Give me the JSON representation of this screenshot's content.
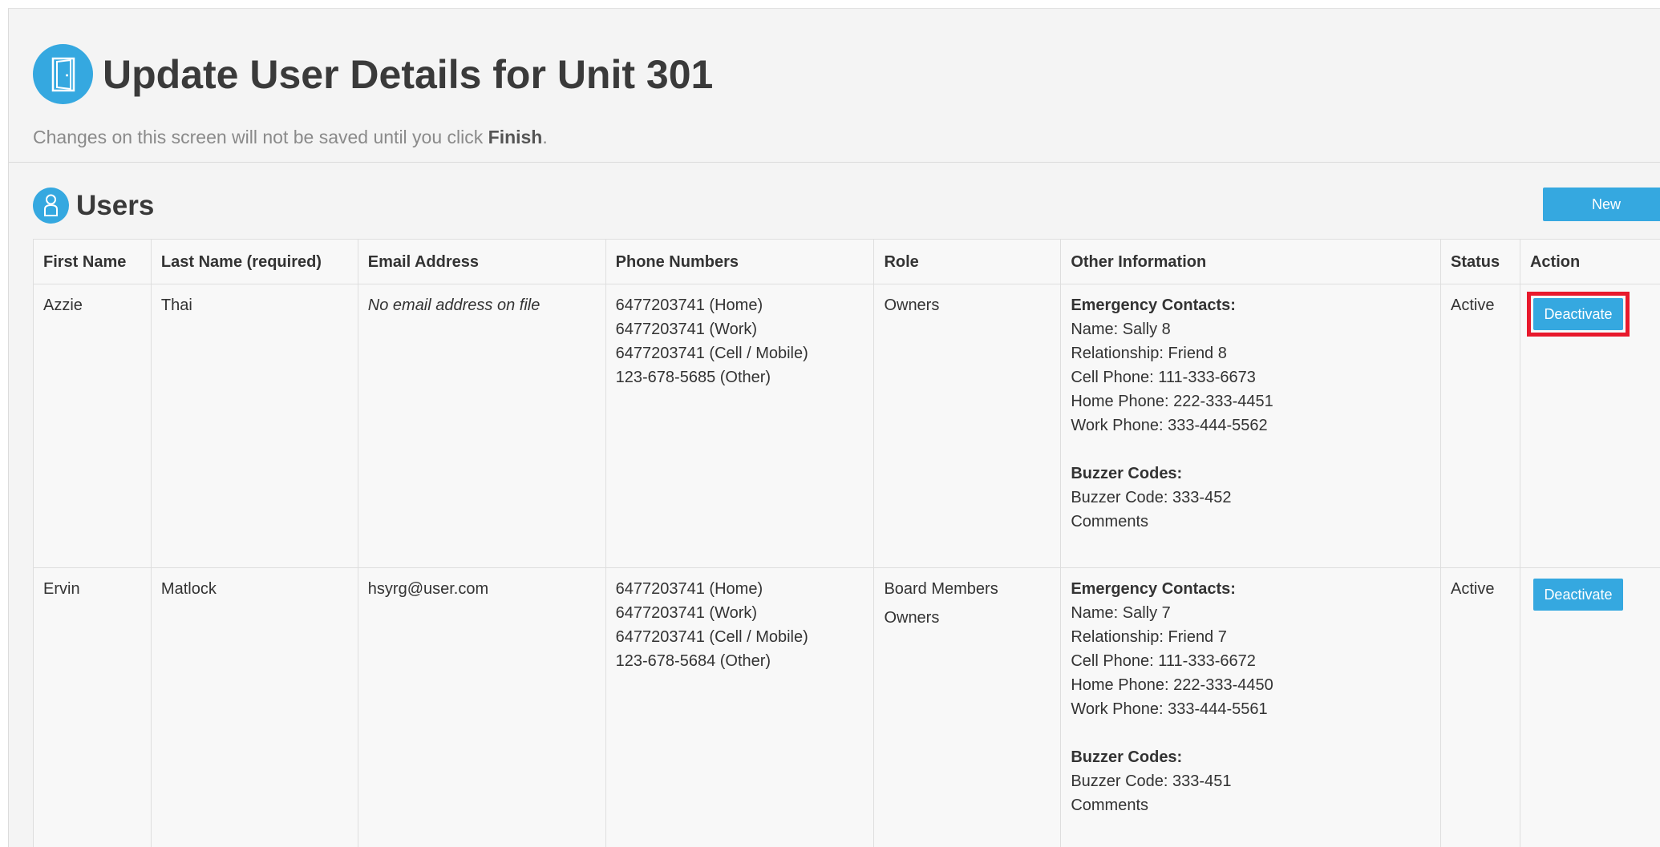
{
  "header": {
    "title": "Update User Details for Unit 301",
    "subtitle_prefix": "Changes on this screen will not be saved until you click ",
    "subtitle_bold": "Finish",
    "subtitle_suffix": ".",
    "icon": "door-icon"
  },
  "users_section": {
    "title": "Users",
    "icon": "person-icon",
    "new_label": "New"
  },
  "table": {
    "columns": [
      "First Name",
      "Last Name (required)",
      "Email Address",
      "Phone Numbers",
      "Role",
      "Other Information",
      "Status",
      "Action"
    ],
    "rows": [
      {
        "first_name": "Azzie",
        "last_name": "Thai",
        "email": "No email address on file",
        "phones": [
          "6477203741 (Home)",
          "6477203741 (Work)",
          "6477203741 (Cell / Mobile)",
          "123-678-5685 (Other)"
        ],
        "roles": [
          "Owners"
        ],
        "emergency_heading": "Emergency Contacts:",
        "emergency": [
          "Name: Sally 8",
          "Relationship: Friend 8",
          "Cell Phone: 111-333-6673",
          "Home Phone: 222-333-4451",
          "Work Phone: 333-444-5562"
        ],
        "buzzer_heading": "Buzzer Codes:",
        "buzzer": [
          "Buzzer Code: 333-452",
          "Comments"
        ],
        "status": "Active",
        "action_label": "Deactivate"
      },
      {
        "first_name": "Ervin",
        "last_name": "Matlock",
        "email": "hsyrg@user.com",
        "phones": [
          "6477203741 (Home)",
          "6477203741 (Work)",
          "6477203741 (Cell / Mobile)",
          "123-678-5684 (Other)"
        ],
        "roles": [
          "Board Members",
          "Owners"
        ],
        "emergency_heading": "Emergency Contacts:",
        "emergency": [
          "Name: Sally 7",
          "Relationship: Friend 7",
          "Cell Phone: 111-333-6672",
          "Home Phone: 222-333-4450",
          "Work Phone: 333-444-5561"
        ],
        "buzzer_heading": "Buzzer Codes:",
        "buzzer": [
          "Buzzer Code: 333-451",
          "Comments"
        ],
        "status": "Active",
        "action_label": "Deactivate"
      }
    ]
  },
  "colors": {
    "accent": "#35a8e0",
    "highlight": "#e8192c"
  }
}
